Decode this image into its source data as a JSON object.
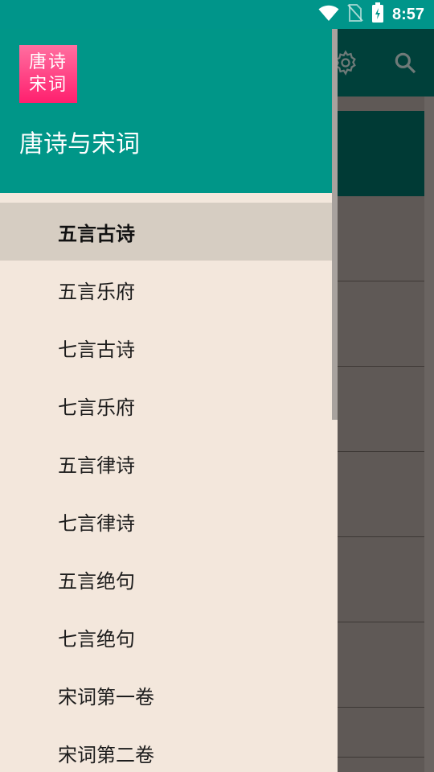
{
  "status_bar": {
    "time": "8:57"
  },
  "background": {
    "toolbar_icons": [
      "gear-icon",
      "search-icon"
    ]
  },
  "drawer": {
    "app_icon_text": [
      "唐诗",
      "宋词"
    ],
    "title": "唐诗与宋词",
    "menu_items": [
      {
        "label": "五言古诗",
        "active": true
      },
      {
        "label": "五言乐府"
      },
      {
        "label": "七言古诗"
      },
      {
        "label": "七言乐府"
      },
      {
        "label": "五言律诗"
      },
      {
        "label": "七言律诗"
      },
      {
        "label": "五言绝句"
      },
      {
        "label": "七言绝句"
      },
      {
        "label": "宋词第一卷"
      },
      {
        "label": "宋词第二卷"
      }
    ]
  },
  "colors": {
    "header": "#009688",
    "drawer_bg": "#f3e7dc",
    "active_item": "#d6cdc2",
    "app_icon": "#ff3a7c"
  }
}
